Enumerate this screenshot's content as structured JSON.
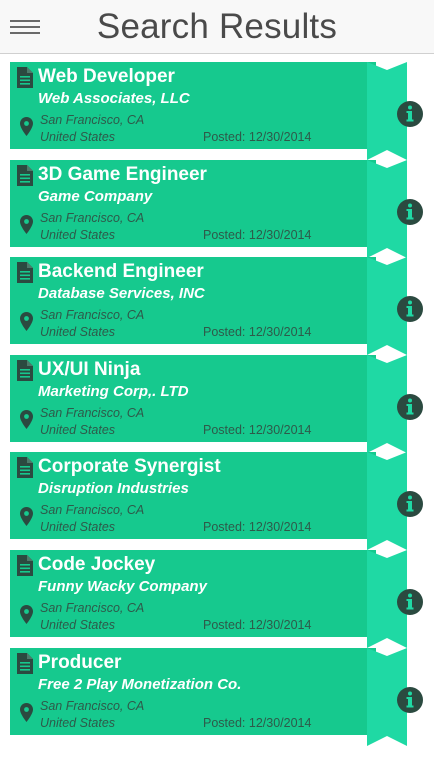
{
  "header": {
    "title": "Search Results",
    "menu_icon": "hamburger-menu-icon"
  },
  "colors": {
    "card_bg": "#16c98e",
    "tab_bg": "#1fd9a4",
    "text_light": "#ffffff",
    "text_dark": "#2e5a4a",
    "icon_dark": "#2b4a40"
  },
  "jobs": [
    {
      "title": "Web Developer",
      "company": "Web Associates, LLC",
      "city": "San Francisco, CA",
      "country": "United States",
      "posted": "Posted: 12/30/2014"
    },
    {
      "title": "3D Game Engineer",
      "company": "Game Company",
      "city": "San Francisco, CA",
      "country": "United States",
      "posted": "Posted: 12/30/2014"
    },
    {
      "title": "Backend Engineer",
      "company": "Database Services, INC",
      "city": "San Francisco, CA",
      "country": "United States",
      "posted": "Posted: 12/30/2014"
    },
    {
      "title": "UX/UI Ninja",
      "company": "Marketing Corp,. LTD",
      "city": "San Francisco, CA",
      "country": "United States",
      "posted": "Posted: 12/30/2014"
    },
    {
      "title": "Corporate Synergist",
      "company": "Disruption Industries",
      "city": "San Francisco, CA",
      "country": "United States",
      "posted": "Posted: 12/30/2014"
    },
    {
      "title": "Code Jockey",
      "company": "Funny Wacky Company",
      "city": "San Francisco, CA",
      "country": "United States",
      "posted": "Posted: 12/30/2014"
    },
    {
      "title": "Producer",
      "company": "Free 2 Play Monetization Co.",
      "city": "San Francisco, CA",
      "country": "United States",
      "posted": "Posted: 12/30/2014"
    }
  ]
}
